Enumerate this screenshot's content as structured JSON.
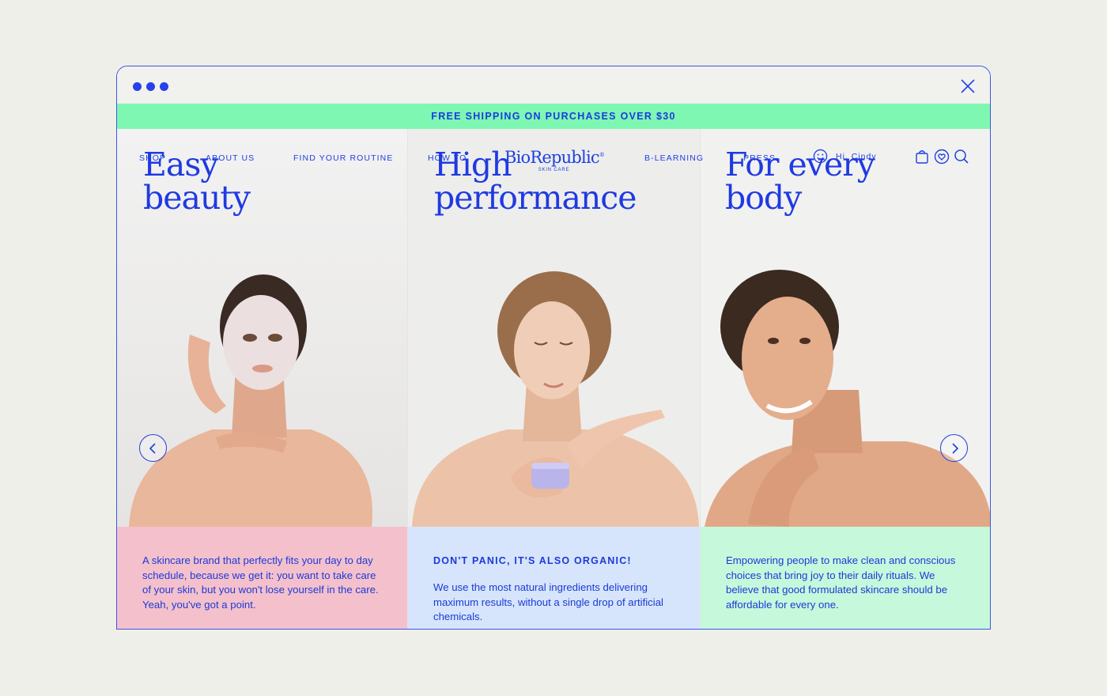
{
  "banner": {
    "text": "FREE SHIPPING ON PURCHASES OVER $30"
  },
  "nav": {
    "shop": "SHOP",
    "about": "ABOUT US",
    "routine": "FIND YOUR ROUTINE",
    "howto": "HOW TO",
    "blearning": "B-LEARNING",
    "press": "PRESS",
    "greeting": "Hi, Cindy"
  },
  "logo": {
    "name": "BioRepublic",
    "mark": "®",
    "tagline": "SKIN CARE"
  },
  "panels": [
    {
      "title_line1": "Easy",
      "title_line2": "beauty",
      "text": "A skincare brand that perfectly fits your day to day schedule, because we get it:  you want to take care of your skin, but you won't lose yourself in the care. Yeah, you've got a point."
    },
    {
      "title_line1": "High",
      "title_line2": "performance",
      "heading": "DON'T PANIC, IT'S ALSO ORGANIC!",
      "text": "We use the most natural ingredients delivering maximum results, without a single drop of artificial chemicals."
    },
    {
      "title_line1": "For every",
      "title_line2": "body",
      "text": "Empowering people to make clean and conscious choices that bring joy to their daily rituals. We believe that good formulated skincare should be affordable for every one."
    }
  ],
  "icons": {
    "window_dots": "window-dots-icon",
    "close": "close-icon",
    "user": "smiley-icon",
    "bag": "shopping-bag-icon",
    "wishlist": "heart-icon",
    "search": "search-icon",
    "prev": "chevron-left-icon",
    "next": "chevron-right-icon"
  },
  "colors": {
    "accent": "#1f3fe0",
    "banner": "#7ef7b3",
    "caption_pink": "#f4c0cc",
    "caption_blue": "#d6e5fb",
    "caption_green": "#c6f8dc"
  }
}
